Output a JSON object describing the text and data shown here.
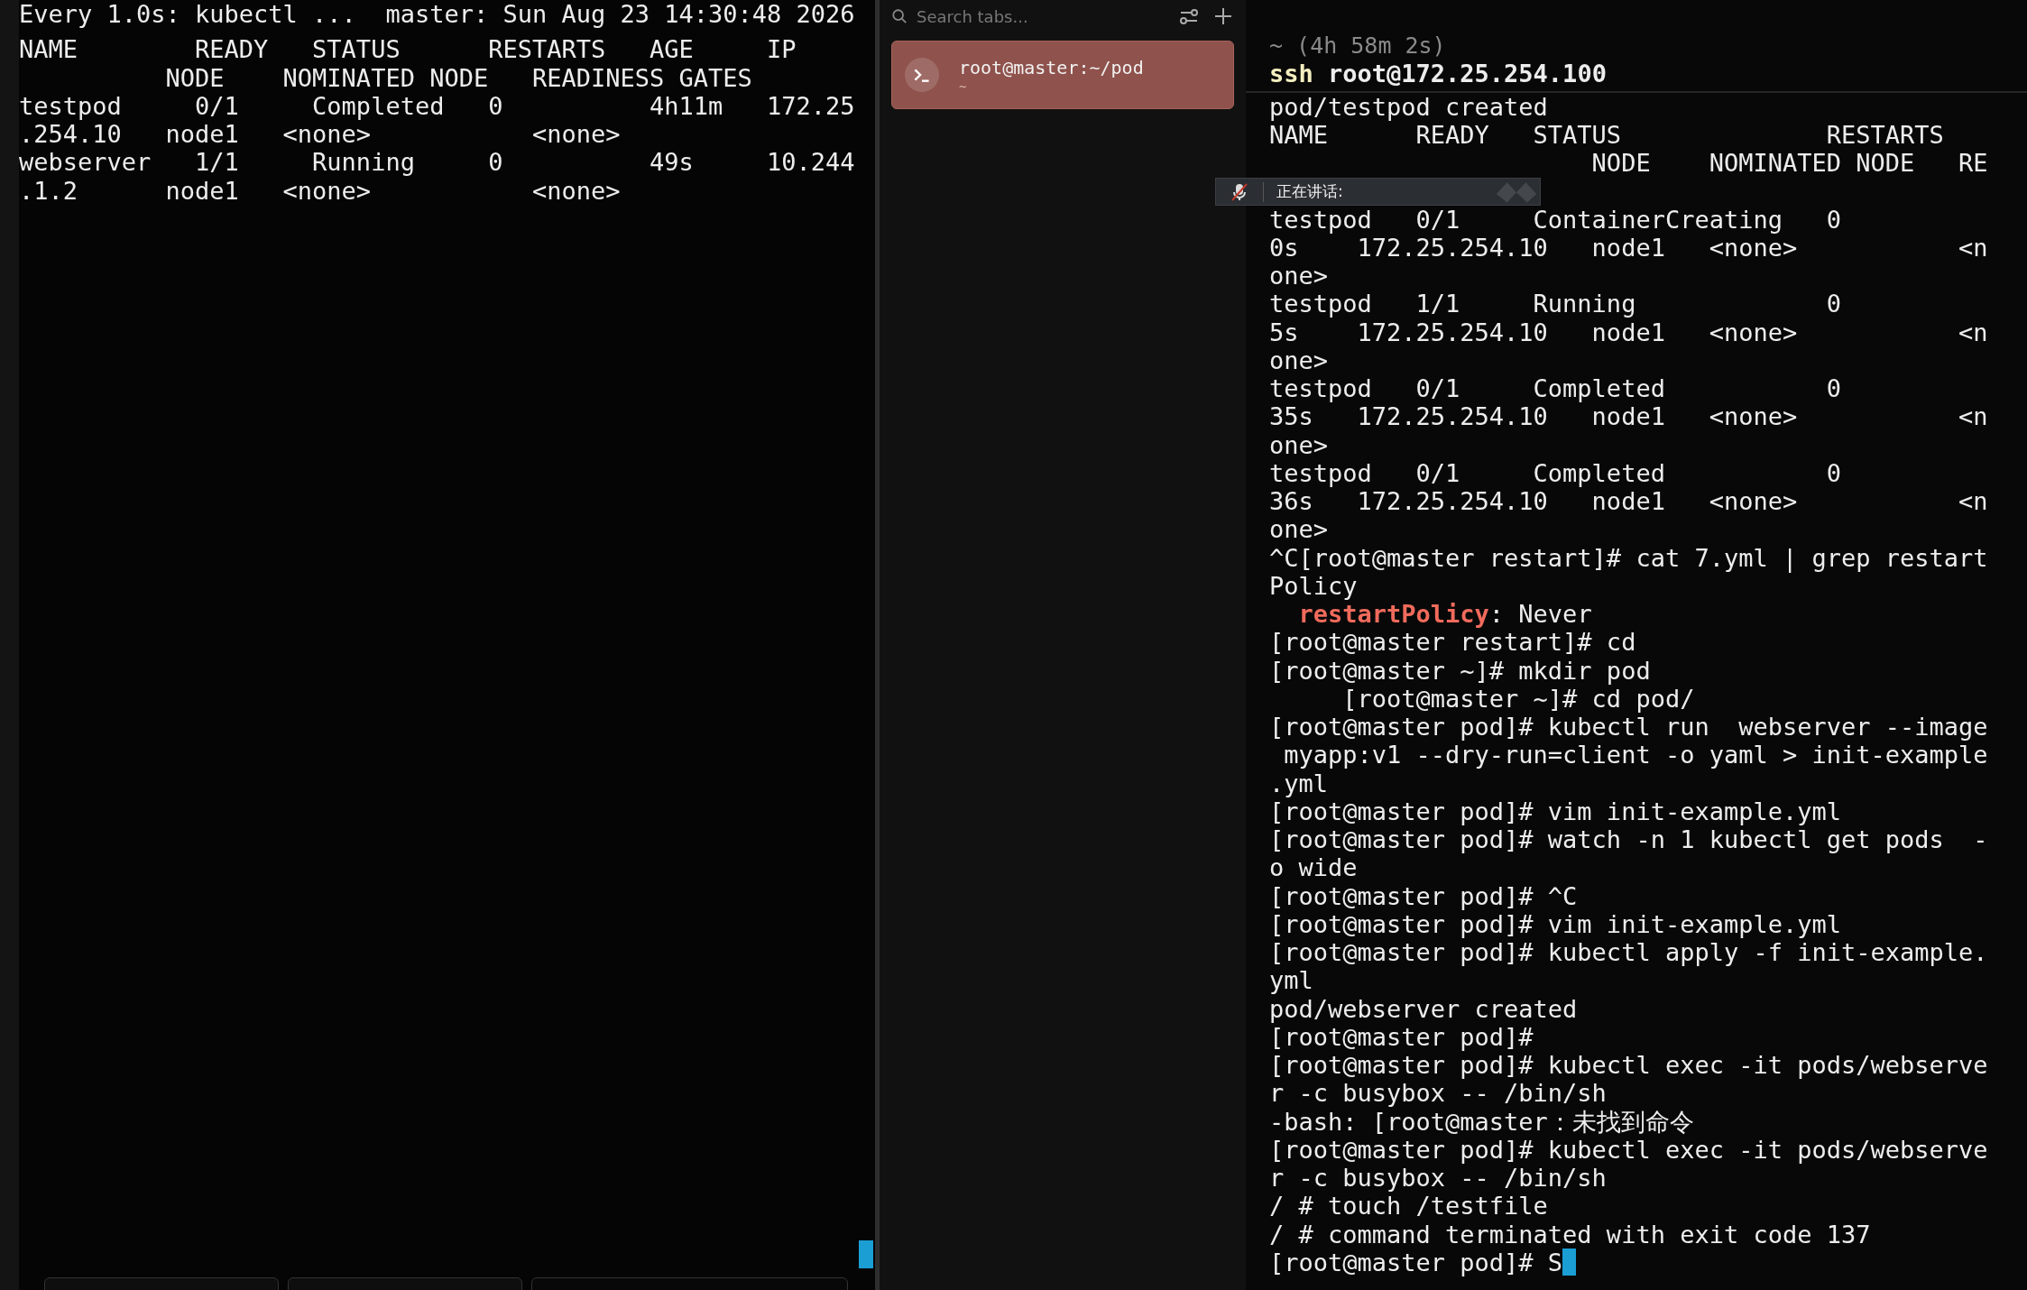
{
  "left_terminal": {
    "title_line": "Every 1.0s: kubectl ...  master: Sun Aug 23 14:30:48 2026",
    "lines": [
      "NAME        READY   STATUS      RESTARTS   AGE     IP",
      "          NODE    NOMINATED NODE   READINESS GATES",
      "testpod     0/1     Completed   0          4h11m   172.25",
      ".254.10   node1   <none>           <none>",
      "webserver   1/1     Running     0          49s     10.244",
      ".1.2      node1   <none>           <none>"
    ],
    "cursor": true,
    "hint_chips": [
      {
        "kind": "chip"
      },
      {
        "kind": "chip"
      },
      {
        "kind": "chip_right"
      }
    ]
  },
  "tab_panel": {
    "search": {
      "placeholder": "Search tabs..."
    },
    "tabs": [
      {
        "title": "root@master:~/pod",
        "subtitle": "~",
        "selected": true
      }
    ]
  },
  "voice_popup": {
    "label": "正在讲话:",
    "muted": true
  },
  "right_terminal": {
    "block_header": {
      "meta": "~ (4h 58m 2s)",
      "program": "ssh",
      "args": " root@172.25.254.100"
    },
    "lines": [
      {
        "kind": "plain",
        "text": "pod/testpod created"
      },
      {
        "kind": "plain",
        "text": "NAME      READY   STATUS              RESTARTS"
      },
      {
        "kind": "plain",
        "text": "                      NODE    NOMINATED NODE   RE"
      },
      {
        "kind": "covered"
      },
      {
        "kind": "plain",
        "text": "testpod   0/1     ContainerCreating   0"
      },
      {
        "kind": "plain",
        "text": "0s    172.25.254.10   node1   <none>           <n"
      },
      {
        "kind": "plain",
        "text": "one>"
      },
      {
        "kind": "plain",
        "text": "testpod   1/1     Running             0"
      },
      {
        "kind": "plain",
        "text": "5s    172.25.254.10   node1   <none>           <n"
      },
      {
        "kind": "plain",
        "text": "one>"
      },
      {
        "kind": "plain",
        "text": "testpod   0/1     Completed           0"
      },
      {
        "kind": "plain",
        "text": "35s   172.25.254.10   node1   <none>           <n"
      },
      {
        "kind": "plain",
        "text": "one>"
      },
      {
        "kind": "plain",
        "text": "testpod   0/1     Completed           0"
      },
      {
        "kind": "plain",
        "text": "36s   172.25.254.10   node1   <none>           <n"
      },
      {
        "kind": "plain",
        "text": "one>"
      },
      {
        "kind": "plain",
        "text": "^C[root@master restart]# cat 7.yml | grep restart"
      },
      {
        "kind": "plain",
        "text": "Policy"
      },
      {
        "kind": "yaml",
        "key": "  restartPolicy",
        "text": ": Never"
      },
      {
        "kind": "plain",
        "text": "[root@master restart]# cd"
      },
      {
        "kind": "plain",
        "text": "[root@master ~]# mkdir pod"
      },
      {
        "kind": "plain",
        "text": "     [root@master ~]# cd pod/"
      },
      {
        "kind": "plain",
        "text": "[root@master pod]# kubectl run  webserver --image"
      },
      {
        "kind": "plain",
        "text": " myapp:v1 --dry-run=client -o yaml > init-example"
      },
      {
        "kind": "plain",
        "text": ".yml"
      },
      {
        "kind": "plain",
        "text": "[root@master pod]# vim init-example.yml"
      },
      {
        "kind": "plain",
        "text": "[root@master pod]# watch -n 1 kubectl get pods  -"
      },
      {
        "kind": "plain",
        "text": "o wide"
      },
      {
        "kind": "plain",
        "text": "[root@master pod]# ^C"
      },
      {
        "kind": "plain",
        "text": "[root@master pod]# vim init-example.yml"
      },
      {
        "kind": "plain",
        "text": "[root@master pod]# kubectl apply -f init-example."
      },
      {
        "kind": "plain",
        "text": "yml"
      },
      {
        "kind": "plain",
        "text": "pod/webserver created"
      },
      {
        "kind": "plain",
        "text": "[root@master pod]#"
      },
      {
        "kind": "plain",
        "text": "[root@master pod]# kubectl exec -it pods/webserve"
      },
      {
        "kind": "plain",
        "text": "r -c busybox -- /bin/sh"
      },
      {
        "kind": "plain",
        "text": "-bash: [root@master：未找到命令"
      },
      {
        "kind": "plain",
        "text": "[root@master pod]# kubectl exec -it pods/webserve"
      },
      {
        "kind": "plain",
        "text": "r -c busybox -- /bin/sh"
      },
      {
        "kind": "plain",
        "text": "/ # touch /testfile"
      },
      {
        "kind": "plain",
        "text": "/ # command terminated with exit code 137"
      },
      {
        "kind": "prompt",
        "text": "[root@master pod]# S",
        "cursor": true
      }
    ]
  }
}
